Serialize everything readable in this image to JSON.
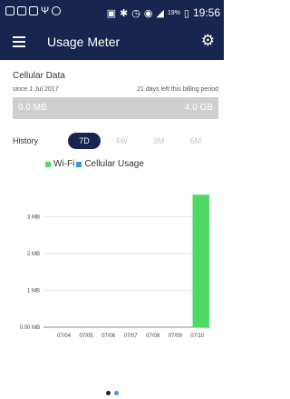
{
  "status_bar": {
    "battery_label": "19%",
    "time": "19:56"
  },
  "app_bar": {
    "title": "Usage Meter"
  },
  "cellular": {
    "title": "Cellular Data",
    "since": "since 1 Jul 2017",
    "days_left": "21 days left this billing period",
    "used": "0.0 MB",
    "limit": "4.0 GB"
  },
  "history": {
    "label": "History",
    "tabs": [
      "7D",
      "4W",
      "3M",
      "6M"
    ],
    "selected": "7D"
  },
  "legend": {
    "wifi": "Wi-Fi",
    "cellular": "Cellular Usage"
  },
  "colors": {
    "primary": "#18254e",
    "wifi": "#4cd964",
    "cellular": "#3a9ad9"
  },
  "chart_data": {
    "type": "bar",
    "categories": [
      "07/04",
      "07/05",
      "07/06",
      "07/07",
      "07/08",
      "07/09",
      "07/10"
    ],
    "series": [
      {
        "name": "Wi-Fi",
        "values": [
          0,
          0,
          0,
          0,
          0,
          0,
          3.6
        ]
      },
      {
        "name": "Cellular Usage",
        "values": [
          0,
          0,
          0,
          0,
          0,
          0,
          0
        ]
      }
    ],
    "y_ticks": [
      "0.00 MB",
      "1 MB",
      "2 MB",
      "3 MB"
    ],
    "ylim": [
      0,
      4
    ]
  },
  "pager": {
    "pages": 2,
    "current": 2
  }
}
